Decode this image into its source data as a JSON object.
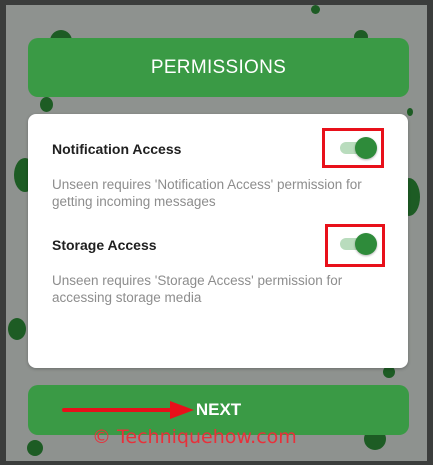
{
  "header": {
    "title": "PERMISSIONS"
  },
  "permissions": [
    {
      "title": "Notification Access",
      "description": "Unseen requires 'Notification Access' permission for getting incoming messages",
      "enabled": true
    },
    {
      "title": "Storage Access",
      "description": "Unseen requires 'Storage Access' permission for accessing storage media",
      "enabled": true
    }
  ],
  "footer": {
    "next_label": "NEXT"
  },
  "watermark": "© Techniquehow.com",
  "colors": {
    "accent_green": "#3a9a45",
    "toggle_thumb": "#2e8b3a",
    "highlight_red": "#e8101a",
    "background_overlay": "#8e928f"
  },
  "icons": {
    "arrow": "right-arrow-icon"
  }
}
